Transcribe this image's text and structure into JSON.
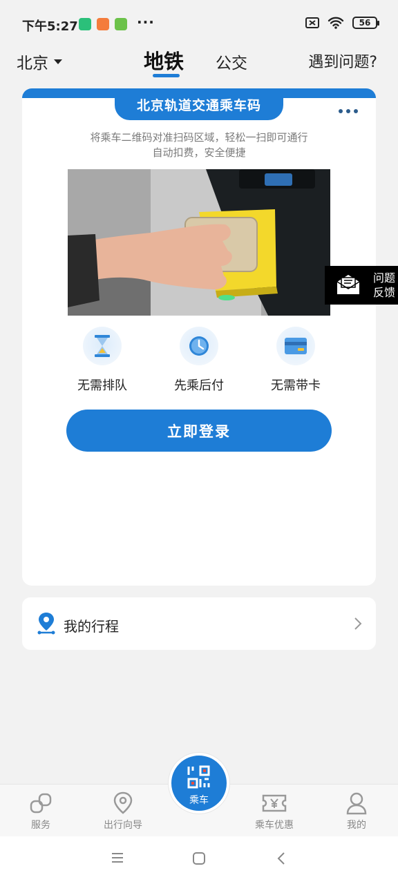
{
  "status_bar": {
    "time": "下午5:27",
    "battery": "56",
    "more": "···"
  },
  "header": {
    "city": "北京",
    "tabs": [
      {
        "label": "地铁",
        "active": true
      },
      {
        "label": "公交",
        "active": false
      }
    ],
    "help": "遇到问题?"
  },
  "card": {
    "title": "北京轨道交通乘车码",
    "subtitle_line1": "将乘车二维码对准扫码区域，轻松一扫即可通行",
    "subtitle_line2": "自动扣费，安全便捷",
    "features": [
      {
        "label": "无需排队"
      },
      {
        "label": "先乘后付"
      },
      {
        "label": "无需带卡"
      }
    ],
    "login_button": "立即登录"
  },
  "trip": {
    "label": "我的行程"
  },
  "feedback": {
    "line1": "问题",
    "line2": "反馈"
  },
  "tabbar": {
    "items": [
      {
        "label": "服务"
      },
      {
        "label": "出行向导"
      },
      {
        "label": "乘车"
      },
      {
        "label": "乘车优惠"
      },
      {
        "label": "我的"
      }
    ]
  },
  "colors": {
    "accent": "#1e7dd6",
    "background": "#f2f2f2"
  }
}
